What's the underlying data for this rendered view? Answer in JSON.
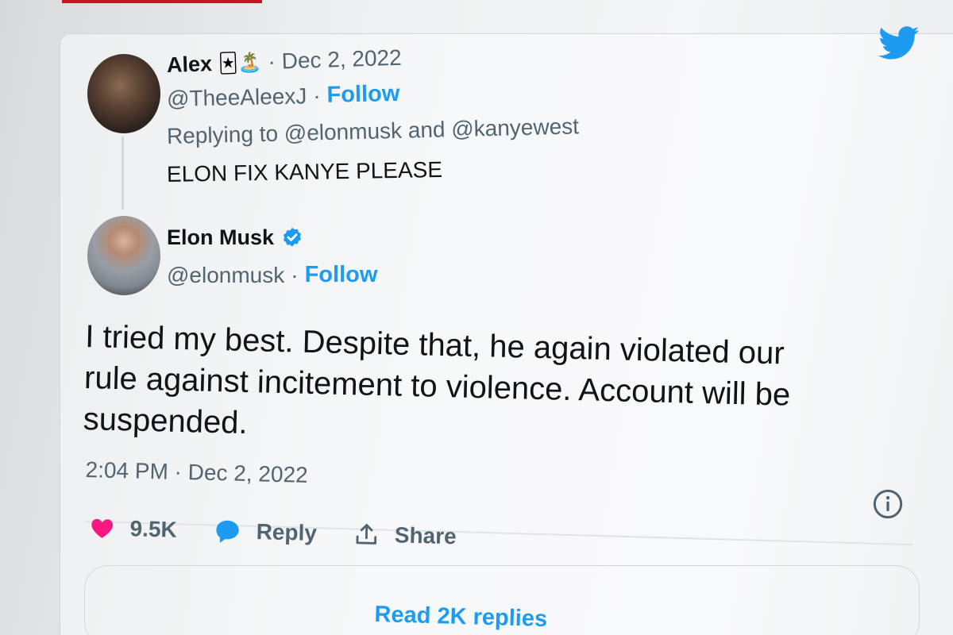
{
  "reply_tweet": {
    "author_name": "Alex",
    "author_emojis": "🃏🏝️",
    "date": "Dec 2, 2022",
    "handle": "@TheeAleexJ",
    "follow_label": "Follow",
    "replying_to": "Replying to @elonmusk and @kanyewest",
    "text": "ELON FIX KANYE PLEASE"
  },
  "main_tweet": {
    "author_name": "Elon Musk",
    "handle": "@elonmusk",
    "follow_label": "Follow",
    "text_lines": [
      "I tried my best. Despite that, he again violated our",
      "rule against incitement to violence. Account will be",
      "suspended."
    ],
    "timestamp": "2:04 PM · Dec 2, 2022"
  },
  "actions": {
    "likes": "9.5K",
    "reply_label": "Reply",
    "share_label": "Share"
  },
  "read_replies_label": "Read 2K replies",
  "separator": "·",
  "colors": {
    "twitter_blue": "#1d9bf0",
    "like_pink": "#f91880",
    "text_dark": "#0f1419",
    "text_gray": "#536471"
  }
}
